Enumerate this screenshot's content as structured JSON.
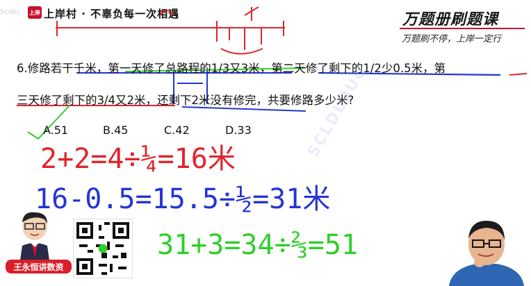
{
  "header": {
    "small_logo": "Scidu",
    "badge": "上岸",
    "slogan": "上岸村 · 不辜负每一次相遇"
  },
  "brand": {
    "title": "万题册刷题课",
    "subtitle": "万题刷不停，上岸一定行"
  },
  "question": {
    "line1": "6.修路若干千米，第一天修了总路程的1/3又3米，第二天修了剩下的1/2少0.5米，第",
    "line2": "三天修了剩下的3/4又2米，还剩下2米没有修完，共要修路多少米?",
    "options": [
      "A.51",
      "B.45",
      "C.42",
      "D.33"
    ]
  },
  "handwriting": {
    "line1": "2+2=4÷¼=16米",
    "line2": "16-0.5=15.5÷½=31米",
    "line3": "31+3=34÷⅔=51",
    "colors": {
      "red": "#e0242b",
      "blue": "#2435d6",
      "green": "#2fcf2a"
    }
  },
  "watermark": "SCLDLOUC",
  "presenter": {
    "tag": "王永恒讲数资"
  }
}
